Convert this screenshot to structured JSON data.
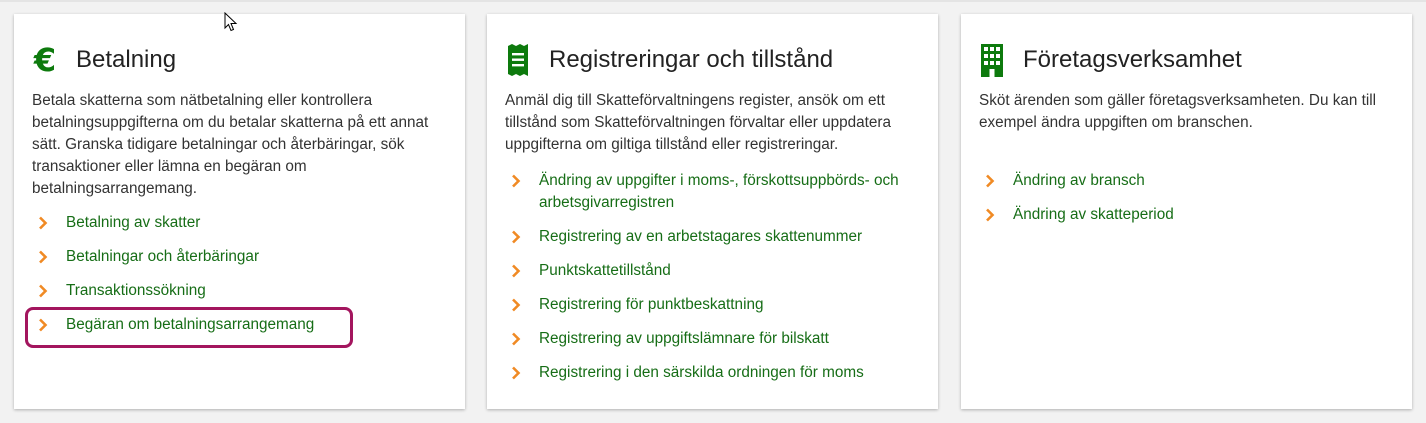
{
  "colors": {
    "accent_green": "#0d7a0d",
    "link_green": "#166d16",
    "chevron_orange": "#f08a24",
    "highlight": "#a3155e"
  },
  "cards": [
    {
      "icon": "euro-icon",
      "title": "Betalning",
      "description": "Betala skatterna som nätbetalning eller kontrollera betalningsuppgifterna om du betalar skatterna på ett annat sätt. Granska tidigare betalningar och återbäringar, sök transaktioner eller lämna en begäran om betalningsarrangemang.",
      "links": [
        "Betalning av skatter",
        "Betalningar och återbäringar",
        "Transaktionssökning",
        "Begäran om betalningsarrangemang"
      ]
    },
    {
      "icon": "receipt-icon",
      "title": "Registreringar och tillstånd",
      "description": "Anmäl dig till Skatteförvaltningens register, ansök om ett tillstånd som Skatteförvaltningen förvaltar eller uppdatera uppgifterna om giltiga tillstånd eller registreringar.",
      "links": [
        "Ändring av uppgifter i moms-, förskottsuppbörds- och arbetsgivarregistren",
        "Registrering av en arbetstagares skattenummer",
        "Punktskattetillstånd",
        "Registrering för punktbeskattning",
        "Registrering av uppgiftslämnare för bilskatt",
        "Registrering i den särskilda ordningen för moms"
      ]
    },
    {
      "icon": "building-icon",
      "title": "Företagsverksamhet",
      "description": "Sköt ärenden som gäller företagsverksamheten. Du kan till exempel ändra uppgiften om branschen.",
      "links": [
        "Ändring av bransch",
        "Ändring av skatteperiod"
      ]
    }
  ]
}
